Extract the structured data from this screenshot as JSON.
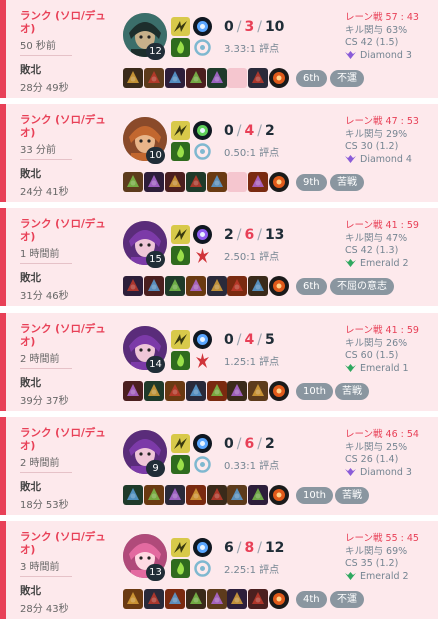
{
  "colors": {
    "loss": "#e84057",
    "row_bg": "#fde9ec",
    "badge_bg": "#8a96a0",
    "text_dark": "#202d37"
  },
  "matches": [
    {
      "queue": "ランク (ソロ/デュオ)",
      "time_ago": "50 秒前",
      "result": "敗北",
      "duration": "28分 49秒",
      "champion_icon": "champion-male-portrait",
      "level": "12",
      "spells": [
        "flash",
        "ignite"
      ],
      "runes": [
        "keystone-blue",
        "precision-secondary"
      ],
      "kda": {
        "k": "0",
        "d": "3",
        "a": "10"
      },
      "ratio": "3.33:1 評点",
      "laning": "レーン戦 57 : 43",
      "kp": "キル関与 63%",
      "cs": "CS 42 (1.5)",
      "rank": "Diamond 3",
      "rank_tier": "diamond",
      "items": [
        "item-1",
        "item-2",
        "item-3",
        "item-4",
        "item-5",
        "empty",
        "item-7",
        "ward"
      ],
      "badges": [
        "6th",
        "不運"
      ]
    },
    {
      "queue": "ランク (ソロ/デュオ)",
      "time_ago": "33 分前",
      "result": "敗北",
      "duration": "24分 41秒",
      "champion_icon": "champion-female-portrait",
      "level": "10",
      "spells": [
        "flash",
        "ignite"
      ],
      "runes": [
        "keystone-green",
        "precision-secondary"
      ],
      "kda": {
        "k": "0",
        "d": "4",
        "a": "2"
      },
      "ratio": "0.50:1 評点",
      "laning": "レーン戦 47 : 53",
      "kp": "キル関与 29%",
      "cs": "CS 30 (1.2)",
      "rank": "Diamond 4",
      "rank_tier": "diamond",
      "items": [
        "item-1",
        "item-2",
        "item-3",
        "item-4",
        "item-5",
        "empty",
        "item-7",
        "ward"
      ],
      "badges": [
        "9th",
        "苦戦"
      ]
    },
    {
      "queue": "ランク (ソロ/デュオ)",
      "time_ago": "1 時間前",
      "result": "敗北",
      "duration": "31分 46秒",
      "champion_icon": "champion-purple-portrait",
      "level": "15",
      "spells": [
        "flash",
        "ignite"
      ],
      "runes": [
        "keystone-purple",
        "domination-secondary"
      ],
      "kda": {
        "k": "2",
        "d": "6",
        "a": "13"
      },
      "ratio": "2.50:1 評点",
      "laning": "レーン戦 41 : 59",
      "kp": "キル関与 47%",
      "cs": "CS 42 (1.3)",
      "rank": "Emerald 2",
      "rank_tier": "emerald",
      "items": [
        "item-1",
        "item-2",
        "item-3",
        "item-4",
        "item-5",
        "item-6",
        "item-7",
        "ward"
      ],
      "badges": [
        "6th",
        "不屈の意志"
      ]
    },
    {
      "queue": "ランク (ソロ/デュオ)",
      "time_ago": "2 時間前",
      "result": "敗北",
      "duration": "39分 37秒",
      "champion_icon": "champion-purple-portrait",
      "level": "14",
      "spells": [
        "flash",
        "ignite"
      ],
      "runes": [
        "keystone-blue",
        "domination-secondary"
      ],
      "kda": {
        "k": "0",
        "d": "4",
        "a": "5"
      },
      "ratio": "1.25:1 評点",
      "laning": "レーン戦 41 : 59",
      "kp": "キル関与 26%",
      "cs": "CS 60 (1.5)",
      "rank": "Emerald 1",
      "rank_tier": "emerald",
      "items": [
        "item-1",
        "item-2",
        "item-3",
        "item-4",
        "item-5",
        "item-6",
        "item-7",
        "ward"
      ],
      "badges": [
        "10th",
        "苦戦"
      ]
    },
    {
      "queue": "ランク (ソロ/デュオ)",
      "time_ago": "2 時間前",
      "result": "敗北",
      "duration": "18分 53秒",
      "champion_icon": "champion-purple-portrait",
      "level": "9",
      "spells": [
        "flash",
        "ignite"
      ],
      "runes": [
        "keystone-blue",
        "precision-secondary"
      ],
      "kda": {
        "k": "0",
        "d": "6",
        "a": "2"
      },
      "ratio": "0.33:1 評点",
      "laning": "レーン戦 46 : 54",
      "kp": "キル関与 25%",
      "cs": "CS 26 (1.4)",
      "rank": "Diamond 3",
      "rank_tier": "diamond",
      "items": [
        "item-1",
        "item-2",
        "item-3",
        "item-4",
        "item-5",
        "item-6",
        "item-7",
        "ward"
      ],
      "badges": [
        "10th",
        "苦戦"
      ]
    },
    {
      "queue": "ランク (ソロ/デュオ)",
      "time_ago": "3 時間前",
      "result": "敗北",
      "duration": "28分 43秒",
      "champion_icon": "champion-pink-portrait",
      "level": "13",
      "spells": [
        "flash",
        "ignite"
      ],
      "runes": [
        "keystone-blue",
        "precision-secondary"
      ],
      "kda": {
        "k": "6",
        "d": "8",
        "a": "12"
      },
      "ratio": "2.25:1 評点",
      "laning": "レーン戦 55 : 45",
      "kp": "キル関与 69%",
      "cs": "CS 35 (1.2)",
      "rank": "Emerald 2",
      "rank_tier": "emerald",
      "items": [
        "item-1",
        "item-2",
        "item-3",
        "item-4",
        "item-5",
        "item-6",
        "item-7",
        "ward"
      ],
      "badges": [
        "4th",
        "不運"
      ]
    }
  ]
}
